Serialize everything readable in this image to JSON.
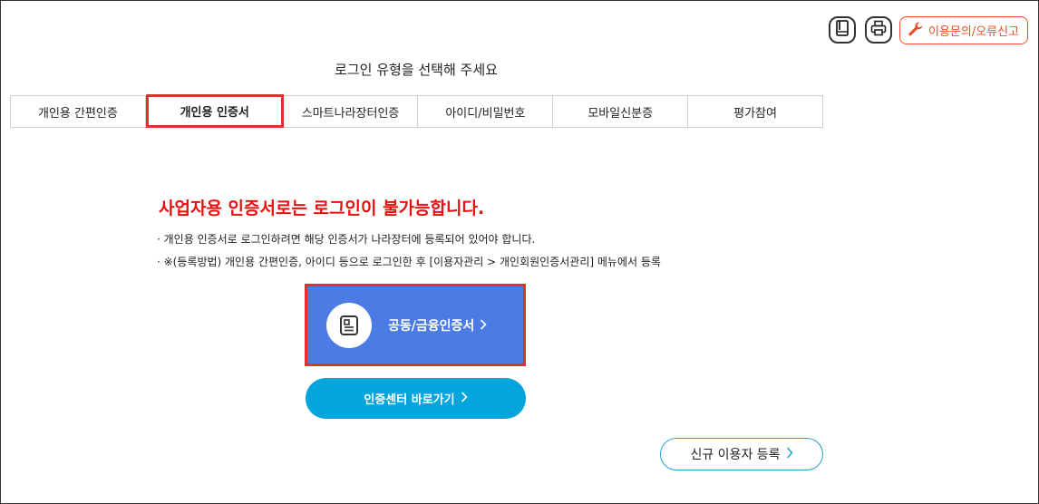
{
  "toolbar": {
    "manual_icon": "book-icon",
    "print_icon": "printer-icon",
    "report_icon": "wrench-icon",
    "report_label": "이용문의/오류신고",
    "accent_color": "#e8502a"
  },
  "page_title": "로그인 유형을 선택해 주세요",
  "tabs": [
    {
      "label": "개인용 간편인증"
    },
    {
      "label": "개인용 인증서",
      "active": true
    },
    {
      "label": "스마트나라장터인증"
    },
    {
      "label": "아이디/비밀번호"
    },
    {
      "label": "모바일신분증"
    },
    {
      "label": "평가참여"
    }
  ],
  "warning": "사업자용 인증서로는 로그인이 불가능합니다.",
  "notes": [
    "· 개인용 인증서로 로그인하려면 해당 인증서가 나라장터에 등록되어 있어야 합니다.",
    "· ※(등록방법) 개인용 간편인증, 아이디 등으로 로그인한 후 [이용자관리 > 개인회원인증서관리] 메뉴에서 등록"
  ],
  "cert_button": {
    "label": "공동/금융인증서",
    "icon": "certificate-icon",
    "color": "#4b7be5"
  },
  "center_button": {
    "label": "인증센터 바로가기",
    "color": "#04a5dc"
  },
  "signup_button": {
    "label": "신규 이용자 등록"
  }
}
